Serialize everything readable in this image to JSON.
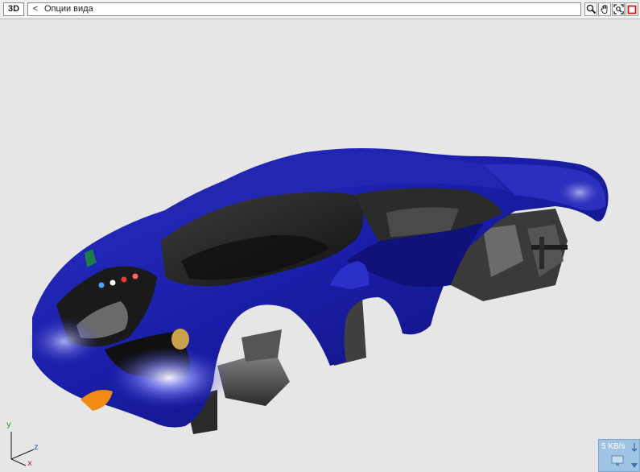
{
  "toolbar": {
    "view_mode_label": "3D",
    "back_label": "<",
    "breadcrumb_label": "Опции вида",
    "tools": [
      "zoom-icon",
      "pan-hand-icon",
      "zoom-extents-icon",
      "maximize-viewport-icon"
    ]
  },
  "viewport": {
    "background": "#e6e6e6",
    "model_color": "#1c1e9e"
  },
  "axis_gizmo": {
    "x_label": "x",
    "y_label": "y",
    "z_label": "z",
    "x_color": "#c8102e",
    "y_color": "#1e8a1e",
    "z_color": "#1a4fc6"
  },
  "network_widget": {
    "speed_text": "5 KB/s"
  }
}
